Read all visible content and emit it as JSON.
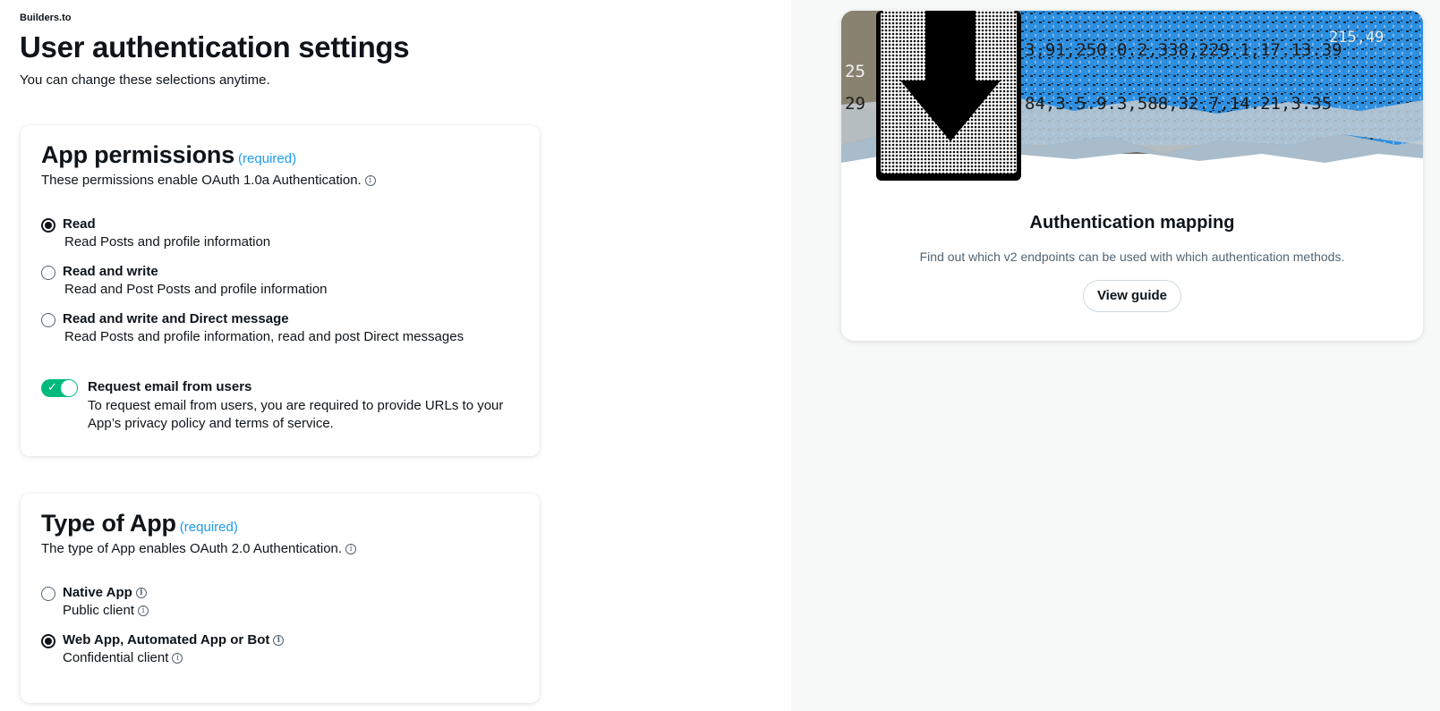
{
  "header": {
    "app_name": "Builders.to",
    "title": "User authentication settings",
    "subtitle": "You can change these selections anytime."
  },
  "app_permissions": {
    "title": "App permissions",
    "required": "(required)",
    "description": "These permissions enable OAuth 1.0a Authentication.",
    "options": [
      {
        "label": "Read",
        "sub": "Read Posts and profile information",
        "selected": true
      },
      {
        "label": "Read and write",
        "sub": "Read and Post Posts and profile information",
        "selected": false
      },
      {
        "label": "Read and write and Direct message",
        "sub": "Read Posts and profile information, read and post Direct messages",
        "selected": false
      }
    ],
    "email_toggle": {
      "label": "Request email from users",
      "description": "To request email from users, you are required to provide URLs to your App’s privacy policy and terms of service.",
      "enabled": true
    }
  },
  "type_of_app": {
    "title": "Type of App",
    "required": "(required)",
    "description": "The type of App enables OAuth 2.0 Authentication.",
    "options": [
      {
        "label": "Native App",
        "sub": "Public client",
        "selected": false
      },
      {
        "label": "Web App, Automated App or Bot",
        "sub": "Confidential client",
        "selected": true
      }
    ]
  },
  "mapping_card": {
    "title": "Authentication mapping",
    "description": "Find out which v2 endpoints can be used with which authentication methods.",
    "button": "View guide"
  },
  "icons": {
    "info": "info-icon",
    "toggle_check": "check-icon",
    "banner_arrow": "arrow-down-icon"
  },
  "colors": {
    "accent": "#1d9bf0",
    "toggle_on": "#00ba7c",
    "text": "#0f1419",
    "muted": "#536471",
    "panel_bg": "#f7f8f8"
  }
}
